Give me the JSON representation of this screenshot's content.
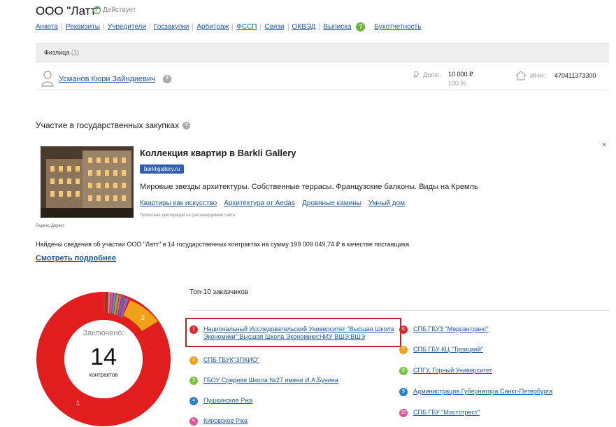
{
  "company": {
    "title": "ООО \"Латт\"",
    "status": "Действует"
  },
  "tabs": [
    "Анкета",
    "Реквизиты",
    "Учредители",
    "Госзакупки",
    "Арбитраж",
    "ФССП",
    "Связи",
    "ОКВЭД",
    "Выписка",
    "Бухотчетность"
  ],
  "section": {
    "title": "Физлица",
    "count": "(1)"
  },
  "person": {
    "name": "Усманов Кюри Зайндиевич",
    "share_label": "Доля:",
    "share_amount": "10 000 ₽",
    "share_percent": "100 %",
    "inn_label": "ИНН:",
    "inn_value": "470411373300"
  },
  "procurement": {
    "title": "Участие в государственных закупках",
    "found_text": "Найдены сведения об участии ООО \"Латт\" в 14 государственных контрактах на сумму 199 009 049,74 ₽ в качестве поставщика.",
    "more_link": "Смотреть подробнее"
  },
  "ad": {
    "title": "Коллекция квартир в Barkli Gallery",
    "domain": "barkligallery.ru",
    "description": "Мировые звезды архитектуры. Собственные террасы. Французские балконы. Виды на Кремль",
    "links": [
      "Квартиры как искусство",
      "Архитектура от Aedas",
      "Дровяные камины",
      "Умный дом"
    ],
    "disclaimer": "Проектная декларация на рекламируемом сайте",
    "source": "Яндекс.Директ",
    "close": "×"
  },
  "donut": {
    "caption": "Заключено:",
    "number": "14",
    "unit": "контрактов",
    "label_1": "1",
    "label_2": "2"
  },
  "top10": {
    "title": "Топ-10 заказчиков",
    "customers": [
      {
        "num": "1",
        "name": "Национальный Исследовательский Университет \"Высшая Школа Экономики\";Высшая Школа Экономики;НИУ ВШЭ;ВШЭ",
        "color": "#e02a2a"
      },
      {
        "num": "2",
        "name": "СПБ ГБУК\"ЗПКИО\"",
        "color": "#f0a019"
      },
      {
        "num": "3",
        "name": "ГБОУ Средняя Школа №27 имени И.А.Бунина",
        "color": "#7cc242"
      },
      {
        "num": "4",
        "name": "Пушкинское Ржа",
        "color": "#2a7fcf"
      },
      {
        "num": "5",
        "name": "Кировское Ржа",
        "color": "#e2559a"
      },
      {
        "num": "6",
        "name": "СПБ ГБУЗ \"Медсантранс\"",
        "color": "#e02a2a"
      },
      {
        "num": "7",
        "name": "СПБ ГБУ КЦ \"Троицкий\"",
        "color": "#f0a019"
      },
      {
        "num": "8",
        "name": "СПГУ, Горный Университет",
        "color": "#7cc242"
      },
      {
        "num": "9",
        "name": "Администрация Губернатора Санкт-Петербурга",
        "color": "#2a7fcf"
      },
      {
        "num": "10",
        "name": "СПБ ГБУ \"Мостотрест\"",
        "color": "#e2559a"
      }
    ]
  }
}
